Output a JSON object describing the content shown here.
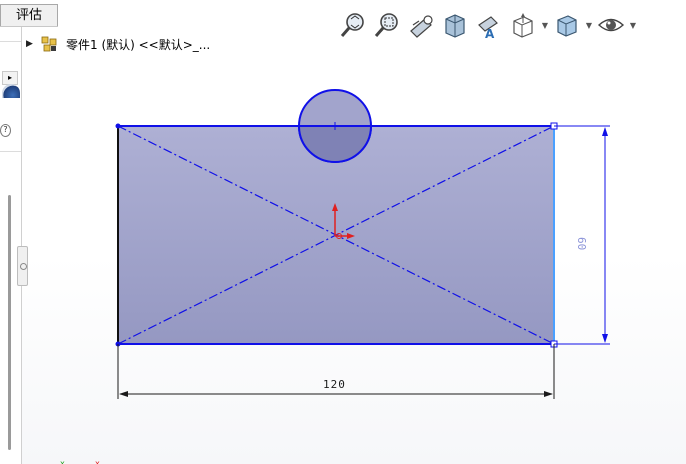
{
  "tabs": {
    "evaluate": "评估"
  },
  "tree": {
    "part_label": "零件1 (默认) <<默认>_..."
  },
  "toolbar": {
    "buttons": [
      {
        "icon": "zoom-to-fit-icon"
      },
      {
        "icon": "zoom-to-area-icon"
      },
      {
        "icon": "previous-view-icon"
      },
      {
        "icon": "section-view-icon"
      },
      {
        "icon": "view-orientation-icon"
      },
      {
        "icon": "display-style-icon"
      },
      {
        "icon": "hide-show-items-icon"
      },
      {
        "icon": "edit-appearance-icon"
      }
    ]
  },
  "sketch": {
    "dim_width": "120",
    "dim_height": "60",
    "colors": {
      "line": "#1010e8",
      "fill": "#9a9cc6",
      "fixed_edge": "#101010",
      "selected_edge": "#4aa0ff",
      "dim": "#1a1a1a",
      "dim_text_height": "#8a92d8",
      "origin": "#e02020"
    }
  }
}
